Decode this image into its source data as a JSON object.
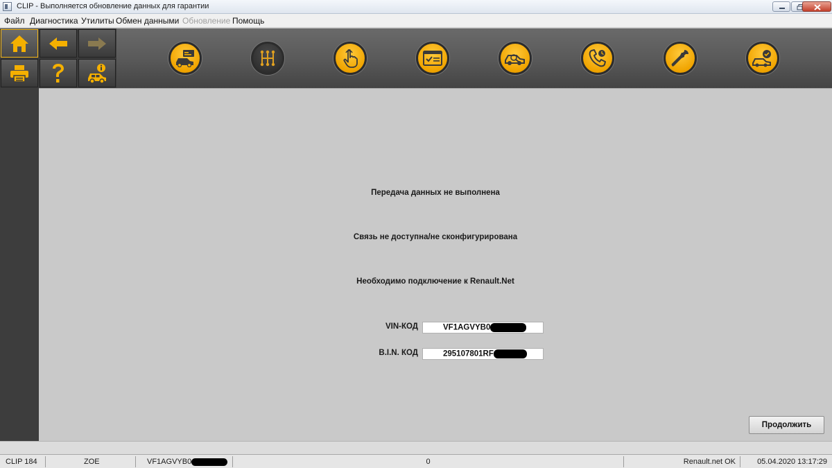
{
  "window": {
    "title": "CLIP - Выполняется обновление данных для гарантии"
  },
  "menu": {
    "items": [
      {
        "label": "Файл",
        "enabled": true
      },
      {
        "label": "Диагностика",
        "enabled": true
      },
      {
        "label": "Утилиты",
        "enabled": true
      },
      {
        "label": "Обмен данными",
        "enabled": true
      },
      {
        "label": "Обновление",
        "enabled": false
      },
      {
        "label": "Помощь",
        "enabled": true
      }
    ]
  },
  "nav_buttons": [
    {
      "name": "home",
      "icon": "home-icon",
      "enabled": true
    },
    {
      "name": "back",
      "icon": "arrow-left-icon",
      "enabled": true
    },
    {
      "name": "forward",
      "icon": "arrow-right-icon",
      "enabled": false
    },
    {
      "name": "print",
      "icon": "printer-icon",
      "enabled": true
    },
    {
      "name": "help",
      "icon": "question-icon",
      "enabled": true
    },
    {
      "name": "vehicle-info",
      "icon": "vehicle-info-icon",
      "enabled": true
    }
  ],
  "toolbar": {
    "icons": [
      "vehicle-identification-icon",
      "gearbox-icon",
      "touch-icon",
      "checklist-card-icon",
      "vehicle-diagnostic-icon",
      "phone-support-icon",
      "wrench-icon",
      "vehicle-check-icon"
    ],
    "active_index": 1
  },
  "main": {
    "messages": [
      "Передача данных не выполнена",
      "Связь не доступна/не сконфигурирована",
      "Необходимо подключение к Renault.Net"
    ],
    "fields": [
      {
        "label": "VIN-КОД",
        "value": "VF1AGVYB0"
      },
      {
        "label": "B.I.N. КОД",
        "value": "295107801RF"
      }
    ],
    "continue_label": "Продолжить"
  },
  "status": {
    "clip_version": "CLIP 184",
    "model": "ZOE",
    "vin": "VF1AGVYB0",
    "counter": "0",
    "network": "Renault.net OK",
    "datetime": "05.04.2020 13:17:29"
  },
  "colors": {
    "accent": "#f5a800",
    "toolbar": "#5a5a5a",
    "background": "#c9c9c9"
  }
}
